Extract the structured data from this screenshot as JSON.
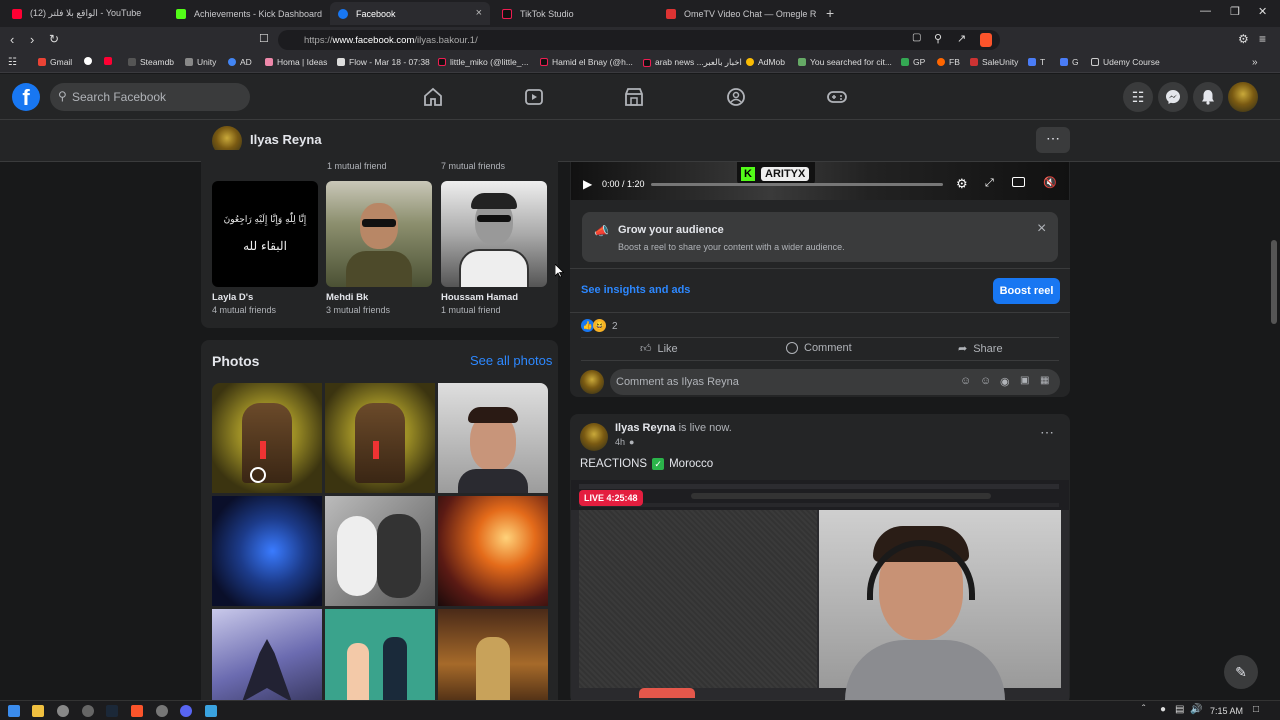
{
  "browser": {
    "tabs": [
      {
        "label": "(12) الواقع بلا فلتر - YouTube",
        "close": "×"
      },
      {
        "label": "Achievements - Kick Dashboard",
        "close": "×"
      },
      {
        "label": "Facebook",
        "close": "×"
      },
      {
        "label": "TikTok Studio",
        "close": "×"
      },
      {
        "label": "OmeTV Video Chat — Omegle R",
        "close": "×"
      }
    ],
    "url_prefix": "https://",
    "url_domain": "www.facebook.com",
    "url_path": "/ilyas.bakour.1/",
    "bookmarks": [
      "Gmail",
      "Steamdb",
      "Unity",
      "AD",
      "Homa | Ideas",
      "Flow - Mar 18 - 07:38",
      "little_miko (@little_...",
      "Hamid el Bnay (@h...",
      "arab news ...اخبار بالعبر",
      "AdMob",
      "You searched for cit...",
      "GP",
      "FB",
      "SaleUnity",
      "T",
      "G",
      "Udemy Course"
    ]
  },
  "fb": {
    "search_placeholder": "Search Facebook",
    "profile_name": "Ilyas Reyna"
  },
  "friends": {
    "top_mutuals": [
      "1 mutual friend",
      "7 mutual friends"
    ],
    "list": [
      {
        "name": "Layla D's",
        "mutual": "4 mutual friends"
      },
      {
        "name": "Mehdi Bk",
        "mutual": "3 mutual friends"
      },
      {
        "name": "Houssam Hamad",
        "mutual": "1 mutual friend"
      }
    ],
    "layla_arabic_1": "إِنَّا لِلّٰهِ وَإِنَّا إِلَيْهِ رَاجِعُونَ",
    "layla_arabic_2": "البقاء لله"
  },
  "photos": {
    "title": "Photos",
    "see_all": "See all photos"
  },
  "video": {
    "time": "0:00 / 1:20",
    "progress": 0,
    "brand": "ARITYX",
    "brand_mark": "K"
  },
  "boost": {
    "title": "Grow your audience",
    "desc": "Boost a reel to share your content with a wider audience.",
    "close": "×",
    "insights_link": "See insights and ads",
    "boost_button": "Boost reel"
  },
  "post1": {
    "reaction_count": "2",
    "like": "Like",
    "comment": "Comment",
    "share": "Share",
    "comment_placeholder": "Comment as Ilyas Reyna"
  },
  "post2": {
    "author": "Ilyas Reyna",
    "status": "is live now.",
    "time": "4h",
    "text_before": "REACTIONS",
    "text_after": "Morocco",
    "live_badge": "LIVE 4:25:48"
  },
  "taskbar": {
    "time": "7:15 AM"
  },
  "colors": {
    "fb_blue": "#1877f2",
    "card_bg": "#242526",
    "page_bg": "#18191a",
    "live_red": "#e41e3f"
  }
}
